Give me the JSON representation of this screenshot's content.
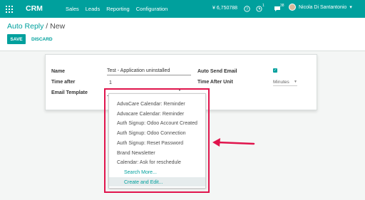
{
  "topbar": {
    "brand": "CRM",
    "menu": [
      "Sales",
      "Leads",
      "Reporting",
      "Configuration"
    ],
    "balance": "¥ 6,750788",
    "activity_count": "1",
    "messages_count": "38",
    "user_name": "Nicola Di Santantonio"
  },
  "breadcrumb": {
    "parent": "Auto Reply",
    "separator": "/",
    "current": "New"
  },
  "buttons": {
    "save": "SAVE",
    "discard": "DISCARD"
  },
  "form": {
    "name_label": "Name",
    "name_value": "Test - Application uninstalled",
    "time_after_label": "Time after",
    "time_after_value": "1",
    "email_template_label": "Email Template",
    "auto_send_label": "Auto Send Email",
    "auto_send_checked": true,
    "time_after_unit_label": "Time After Unit",
    "time_after_unit_value": "Minutes"
  },
  "dropdown": {
    "options": [
      "AdvaCare Calendar: Reminder",
      "Advacare Calendar: Reminder",
      "Auth Signup: Odoo Account Created",
      "Auth Signup: Odoo Connection",
      "Auth Signup: Reset Password",
      "Brand Newsletter",
      "Calendar: Ask for reschedule"
    ],
    "search_more": "Search More...",
    "create_edit": "Create and Edit..."
  },
  "colors": {
    "primary": "#00a09d",
    "highlight": "#e0144c"
  }
}
